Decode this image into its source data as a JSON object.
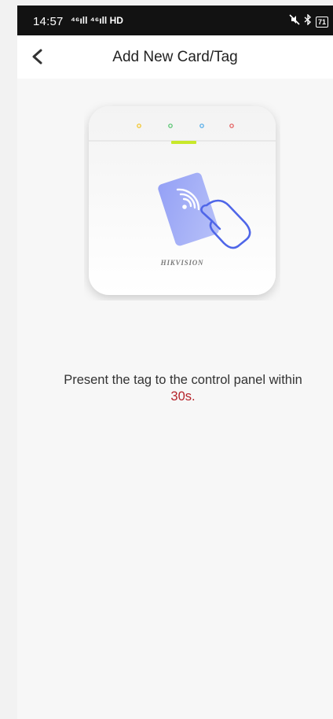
{
  "status_bar": {
    "time": "14:57",
    "signal_text": "⁴⁶ıll ⁴⁶ıll HD",
    "battery": "71"
  },
  "header": {
    "title": "Add New Card/Tag"
  },
  "device": {
    "brand": "HIKVISION",
    "led_colors": [
      "#f2c21e",
      "#4fc36a",
      "#4aa8e8",
      "#e35656"
    ],
    "indicator_color": "#c8e82a"
  },
  "instruction": {
    "text": "Present the tag to the control panel within",
    "countdown": "30s.",
    "countdown_color": "#b5232a"
  }
}
